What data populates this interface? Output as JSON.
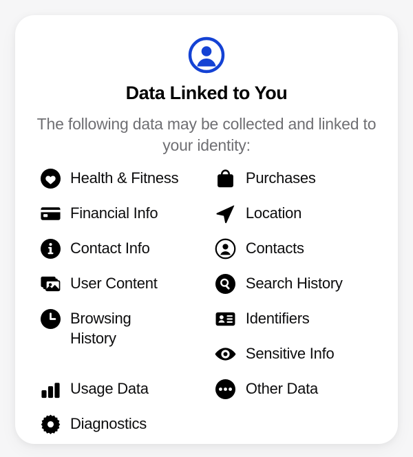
{
  "card": {
    "header": {
      "icon": "person-circle-icon",
      "icon_color": "#1442d4",
      "title": "Data Linked to You",
      "subtitle": "The following data may be collected and linked to your identity:"
    },
    "columns": {
      "left": [
        {
          "icon": "heart-circle-icon",
          "label": "Health & Fitness"
        },
        {
          "icon": "credit-card-icon",
          "label": "Financial Info"
        },
        {
          "icon": "info-circle-icon",
          "label": "Contact Info"
        },
        {
          "icon": "photos-stack-icon",
          "label": "User Content"
        },
        {
          "icon": "clock-icon",
          "label": "Browsing History"
        },
        {
          "icon": "bar-chart-icon",
          "label": "Usage Data"
        },
        {
          "icon": "gear-icon",
          "label": "Diagnostics"
        }
      ],
      "right": [
        {
          "icon": "shopping-bag-icon",
          "label": "Purchases"
        },
        {
          "icon": "location-arrow-icon",
          "label": "Location"
        },
        {
          "icon": "person-circle-outline-icon",
          "label": "Contacts"
        },
        {
          "icon": "magnifier-circle-icon",
          "label": "Search History"
        },
        {
          "icon": "id-card-icon",
          "label": "Identifiers"
        },
        {
          "icon": "eye-icon",
          "label": "Sensitive Info"
        },
        {
          "icon": "ellipsis-circle-icon",
          "label": "Other Data"
        }
      ]
    }
  },
  "colors": {
    "page_background": "#f6f6f7",
    "card_background": "#ffffff",
    "title_text": "#000000",
    "subtitle_text": "#6f6f73",
    "item_text": "#0c0c0d",
    "icon": "#000000",
    "accent_blue": "#1442d4"
  }
}
